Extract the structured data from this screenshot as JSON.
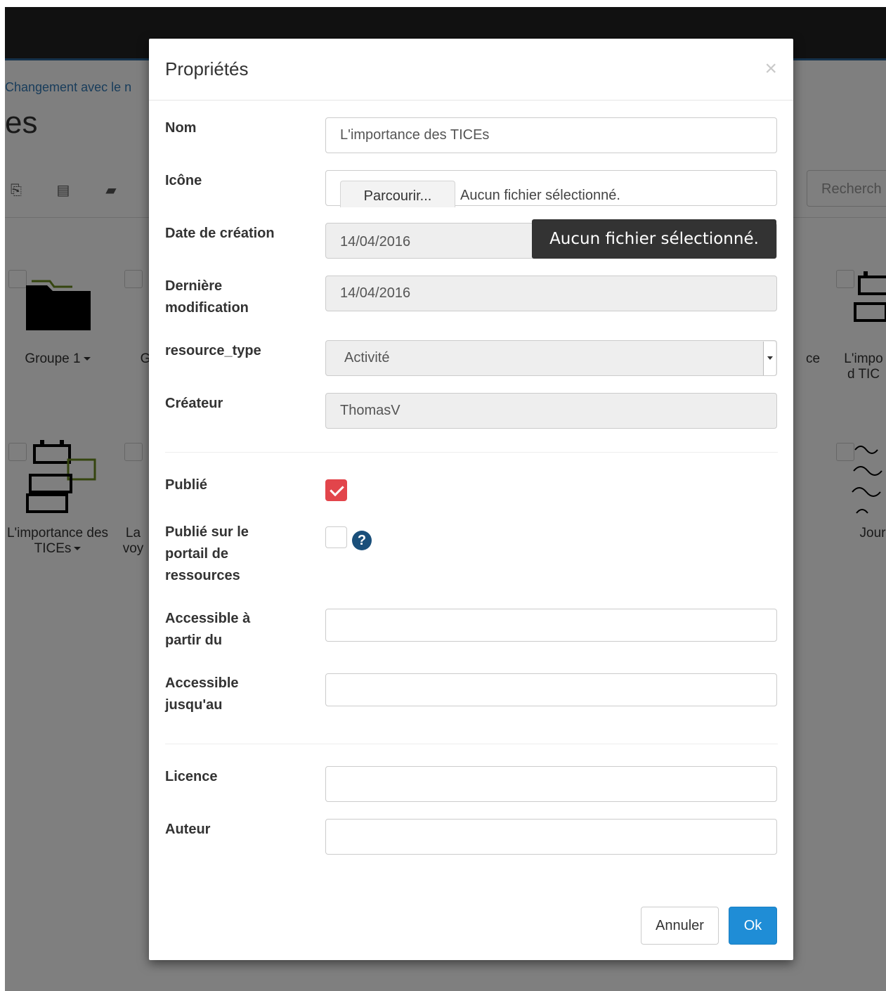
{
  "background": {
    "breadcrumb": "Changement avec le n",
    "page_title": "es",
    "search_placeholder": "Recherch",
    "tiles_row1": [
      {
        "label": "Groupe 1"
      },
      {
        "label": "G"
      },
      {
        "label": "ce"
      },
      {
        "label": "L'impo d TIC"
      }
    ],
    "tiles_row2": [
      {
        "label": "L'importance des TICEs"
      },
      {
        "label": "La voy"
      },
      {
        "label": "Jour"
      }
    ]
  },
  "modal": {
    "title": "Propriétés",
    "close": "×",
    "fields": {
      "nom": {
        "label": "Nom",
        "value": "L'importance des TICEs"
      },
      "icone": {
        "label": "Icône",
        "button": "Parcourir...",
        "file_text": "Aucun fichier sélectionné."
      },
      "tooltip": "Aucun fichier sélectionné.",
      "date_creation": {
        "label": "Date de création",
        "value": "14/04/2016"
      },
      "derniere_modification": {
        "label": "Dernière modification",
        "value": "14/04/2016"
      },
      "resource_type": {
        "label": "resource_type",
        "value": "Activité"
      },
      "createur": {
        "label": "Créateur",
        "value": "ThomasV"
      },
      "publie": {
        "label": "Publié",
        "checked": true
      },
      "publie_portail": {
        "label": "Publié sur le portail de ressources",
        "checked": false,
        "help": "?"
      },
      "accessible_debut": {
        "label": "Accessible à partir du",
        "value": ""
      },
      "accessible_fin": {
        "label": "Accessible jusqu'au",
        "value": ""
      },
      "licence": {
        "label": "Licence",
        "value": ""
      },
      "auteur": {
        "label": "Auteur",
        "value": ""
      }
    },
    "buttons": {
      "cancel": "Annuler",
      "ok": "Ok"
    }
  },
  "colors": {
    "accent": "#1f8dd6",
    "checked": "#e2454b",
    "help": "#1a4f7a"
  }
}
